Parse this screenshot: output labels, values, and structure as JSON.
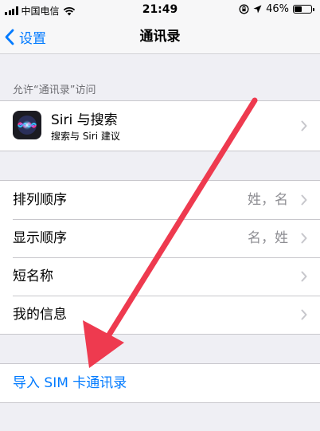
{
  "status_bar": {
    "carrier": "中国电信",
    "time": "21:49",
    "battery_percent": "46%",
    "battery_level": 0.46,
    "icons": [
      "signal-icon",
      "wifi-icon",
      "rotation-lock-icon",
      "location-icon",
      "battery-icon"
    ]
  },
  "nav": {
    "back_label": "设置",
    "title": "通讯录"
  },
  "section_header": "允许“通讯录”访问",
  "siri": {
    "title": "Siri 与搜索",
    "subtitle": "搜索与 Siri 建议"
  },
  "settings_rows": [
    {
      "label": "排列顺序",
      "value": "姓，名"
    },
    {
      "label": "显示顺序",
      "value": "名，姓"
    },
    {
      "label": "短名称",
      "value": ""
    },
    {
      "label": "我的信息",
      "value": ""
    }
  ],
  "import_sim": {
    "label": "导入 SIM 卡通讯录"
  },
  "colors": {
    "accent": "#007aff",
    "annotation_arrow": "#ee3a4f",
    "background": "#efeff4"
  }
}
